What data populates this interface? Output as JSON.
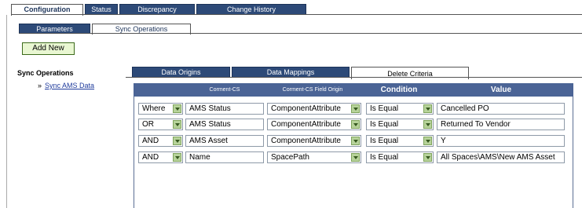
{
  "top_tabs": [
    {
      "label": "Configuration",
      "active": true
    },
    {
      "label": "Status",
      "active": false
    },
    {
      "label": "Discrepancy",
      "active": false
    },
    {
      "label": "Change History",
      "active": false
    }
  ],
  "sub_tabs": [
    {
      "label": "Parameters",
      "active": false
    },
    {
      "label": "Sync Operations",
      "active": true
    }
  ],
  "add_button": "Add New",
  "sidebar": {
    "title": "Sync Operations",
    "bullet": "»",
    "link": "Sync AMS Data"
  },
  "inner_tabs": [
    {
      "label": "Data Origins",
      "active": false
    },
    {
      "label": "Data Mappings",
      "active": false
    },
    {
      "label": "Delete Criteria",
      "active": true
    }
  ],
  "table": {
    "headers": [
      "Corment-CS",
      "Corment-CS Field Origin",
      "Condition",
      "Value"
    ],
    "rows": [
      {
        "op": "Where",
        "field": "AMS Status",
        "origin": "ComponentAttribute",
        "condition": "Is Equal",
        "value": "Cancelled PO"
      },
      {
        "op": "OR",
        "field": "AMS Status",
        "origin": "ComponentAttribute",
        "condition": "Is Equal",
        "value": "Returned To Vendor"
      },
      {
        "op": "AND",
        "field": "AMS Asset",
        "origin": "ComponentAttribute",
        "condition": "Is Equal",
        "value": "Y"
      },
      {
        "op": "AND",
        "field": "Name",
        "origin": "SpacePath",
        "condition": "Is Equal",
        "value": "All Spaces\\AMS\\New AMS Asset"
      }
    ]
  },
  "colors": {
    "tab_blue": "#2d4a78",
    "header_blue": "#4b6496",
    "button_green": "#e9f7d2",
    "arrow_green": "#b7d39a"
  }
}
